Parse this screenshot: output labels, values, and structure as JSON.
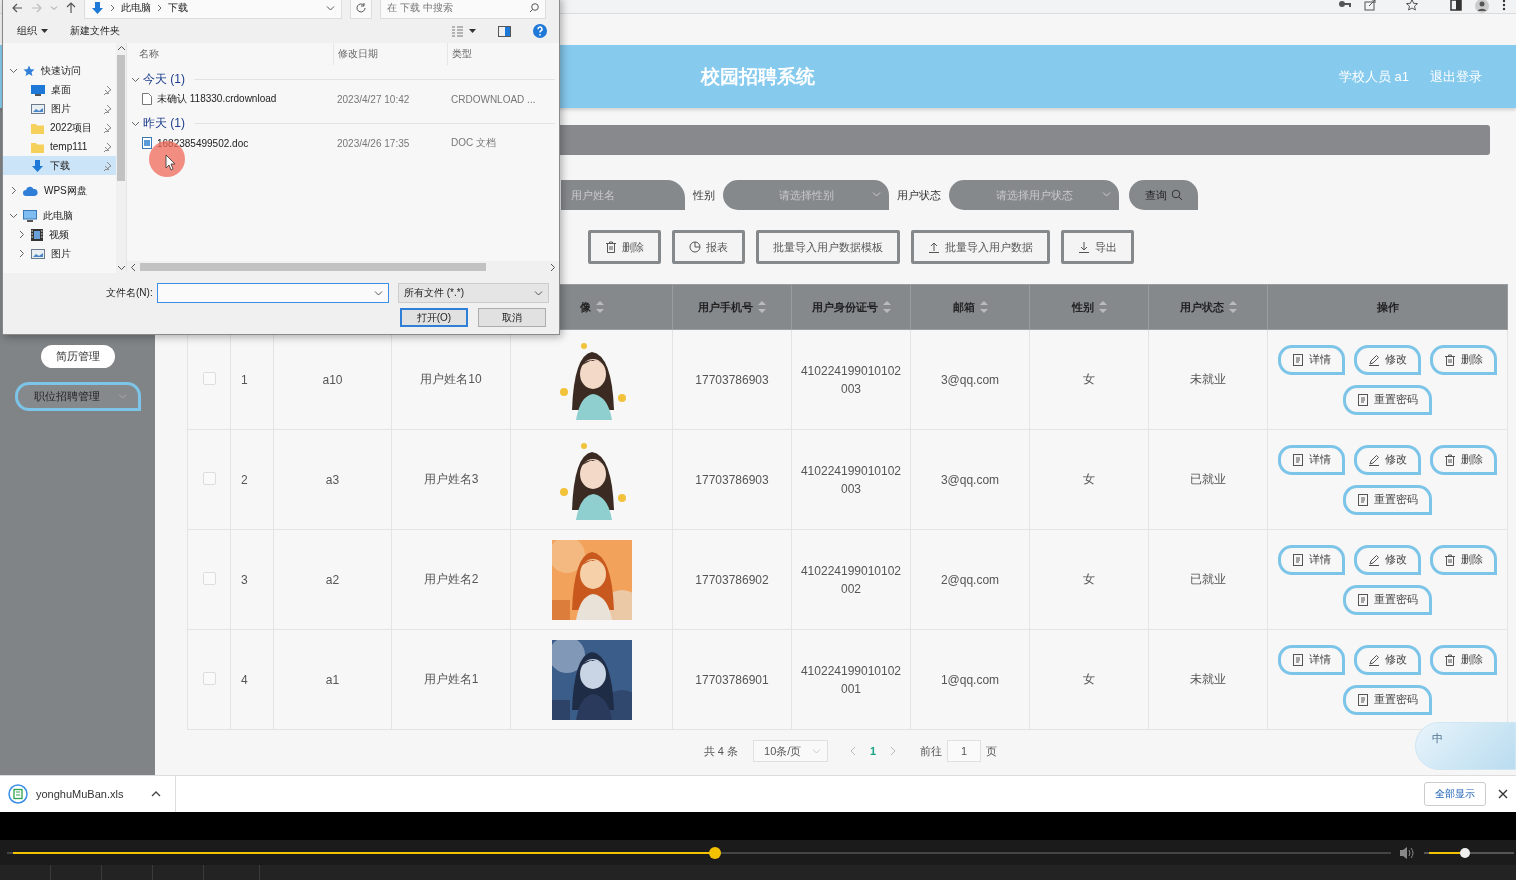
{
  "app": {
    "title": "校园招聘系统",
    "user": "学校人员 a1",
    "logout": "退出登录"
  },
  "sidebar": {
    "items": [
      {
        "label": "简历管理",
        "has_submenu": false
      },
      {
        "label": "职位招聘管理",
        "has_submenu": true
      }
    ]
  },
  "search": {
    "name_field": {
      "placeholder": "用户姓名"
    },
    "gender_label": "性别",
    "gender_select": {
      "placeholder": "请选择性别"
    },
    "status_label": "用户状态",
    "status_select": {
      "placeholder": "请选择用户状态"
    },
    "query_button": "查询"
  },
  "toolbar": [
    {
      "kind": "delete",
      "label": "删除"
    },
    {
      "kind": "report",
      "label": "报表"
    },
    {
      "kind": "template",
      "label": "批量导入用户数据模板"
    },
    {
      "kind": "import",
      "label": "批量导入用户数据"
    },
    {
      "kind": "export",
      "label": "导出"
    }
  ],
  "table": {
    "columns": [
      {
        "label": "像",
        "sortable": true
      },
      {
        "label": "用户手机号",
        "sortable": true
      },
      {
        "label": "用户身份证号",
        "sortable": true
      },
      {
        "label": "邮箱",
        "sortable": true
      },
      {
        "label": "性别",
        "sortable": true
      },
      {
        "label": "用户状态",
        "sortable": true
      },
      {
        "label": "操作",
        "sortable": false
      }
    ],
    "rows": [
      {
        "checked": false,
        "index": "1",
        "account": "a10",
        "name": "用户姓名10",
        "avatar": {
          "kind": "picture"
        },
        "phone": "17703786903",
        "id_number": "410224199010102003",
        "email": "3@qq.com",
        "gender": "女",
        "status": "未就业",
        "actions": [
          {
            "kind": "detail",
            "label": "详情"
          },
          {
            "kind": "edit",
            "label": "修改"
          },
          {
            "kind": "delete",
            "label": "删除"
          },
          {
            "kind": "reset",
            "label": "重置密码"
          }
        ]
      },
      {
        "checked": false,
        "index": "2",
        "account": "a3",
        "name": "用户姓名3",
        "avatar": {
          "kind": "picture"
        },
        "phone": "17703786903",
        "id_number": "410224199010102003",
        "email": "3@qq.com",
        "gender": "女",
        "status": "已就业",
        "actions": [
          {
            "kind": "detail",
            "label": "详情"
          },
          {
            "kind": "edit",
            "label": "修改"
          },
          {
            "kind": "delete",
            "label": "删除"
          },
          {
            "kind": "reset",
            "label": "重置密码"
          }
        ]
      },
      {
        "checked": false,
        "index": "3",
        "account": "a2",
        "name": "用户姓名2",
        "avatar": {
          "kind": "picture"
        },
        "phone": "17703786902",
        "id_number": "410224199010102002",
        "email": "2@qq.com",
        "gender": "女",
        "status": "已就业",
        "actions": [
          {
            "kind": "detail",
            "label": "详情"
          },
          {
            "kind": "edit",
            "label": "修改"
          },
          {
            "kind": "delete",
            "label": "删除"
          },
          {
            "kind": "reset",
            "label": "重置密码"
          }
        ]
      },
      {
        "checked": false,
        "index": "4",
        "account": "a1",
        "name": "用户姓名1",
        "avatar": {
          "kind": "picture"
        },
        "phone": "17703786901",
        "id_number": "410224199010102001",
        "email": "1@qq.com",
        "gender": "女",
        "status": "未就业",
        "actions": [
          {
            "kind": "detail",
            "label": "详情"
          },
          {
            "kind": "edit",
            "label": "修改"
          },
          {
            "kind": "delete",
            "label": "删除"
          },
          {
            "kind": "reset",
            "label": "重置密码"
          }
        ]
      }
    ]
  },
  "pagination": {
    "total": "共 4 条",
    "page_size": "10条/页",
    "pages": [
      {
        "label": "1",
        "selected": true
      }
    ],
    "goto_label": "前往",
    "goto_value": "1",
    "goto_suffix": "页"
  },
  "ime_widget": {
    "label": "中"
  },
  "download_bar": {
    "file": "yonghuMuBan.xls",
    "show_all": "全部显示"
  },
  "video_player": {
    "progress": {
      "level": 0.512
    },
    "volume": {
      "level": 0.45
    }
  },
  "file_dialog": {
    "breadcrumb": [
      "此电脑",
      "下载"
    ],
    "search": {
      "placeholder": "在 下载 中搜索"
    },
    "toolbar": [
      {
        "label": "组织",
        "has_menu": true
      },
      {
        "label": "新建文件夹",
        "has_menu": false
      }
    ],
    "nav": [
      {
        "label": "快速访问",
        "kind": "star",
        "expanded": true,
        "selected": false,
        "children": [
          {
            "label": "桌面",
            "kind": "desktop",
            "pinned": true,
            "selected": false
          },
          {
            "label": "图片",
            "kind": "pictures",
            "pinned": true,
            "selected": false
          },
          {
            "label": "2022项目",
            "kind": "folder",
            "pinned": true,
            "selected": false
          },
          {
            "label": "temp111",
            "kind": "folder",
            "pinned": true,
            "selected": false
          },
          {
            "label": "下载",
            "kind": "downloads",
            "pinned": true,
            "selected": true
          }
        ]
      },
      {
        "label": "WPS网盘",
        "kind": "cloud",
        "expanded": false,
        "selected": false
      },
      {
        "label": "此电脑",
        "kind": "computer",
        "expanded": true,
        "selected": false,
        "children": [
          {
            "label": "视频",
            "kind": "video",
            "expanded": false,
            "selected": false
          },
          {
            "label": "图片",
            "kind": "pictures",
            "expanded": false,
            "selected": false
          }
        ]
      }
    ],
    "columns": [
      "名称",
      "修改日期",
      "类型"
    ],
    "groups": [
      {
        "label": "今天 (1)",
        "expanded": true,
        "files": [
          {
            "name": "未确认 118330.crdownload",
            "modified": "2023/4/27 10:42",
            "type": "CRDOWNLOAD ...",
            "kind": "blank"
          }
        ]
      },
      {
        "label": "昨天 (1)",
        "expanded": true,
        "files": [
          {
            "name": "1682385499502.doc",
            "modified": "2023/4/26 17:35",
            "type": "DOC 文档",
            "kind": "doc"
          }
        ]
      }
    ],
    "filename_label": "文件名(N):",
    "filter": "所有文件 (*.*)",
    "buttons": [
      {
        "label": "打开(O)",
        "kind": "primary"
      },
      {
        "label": "取消",
        "kind": "normal"
      }
    ]
  }
}
